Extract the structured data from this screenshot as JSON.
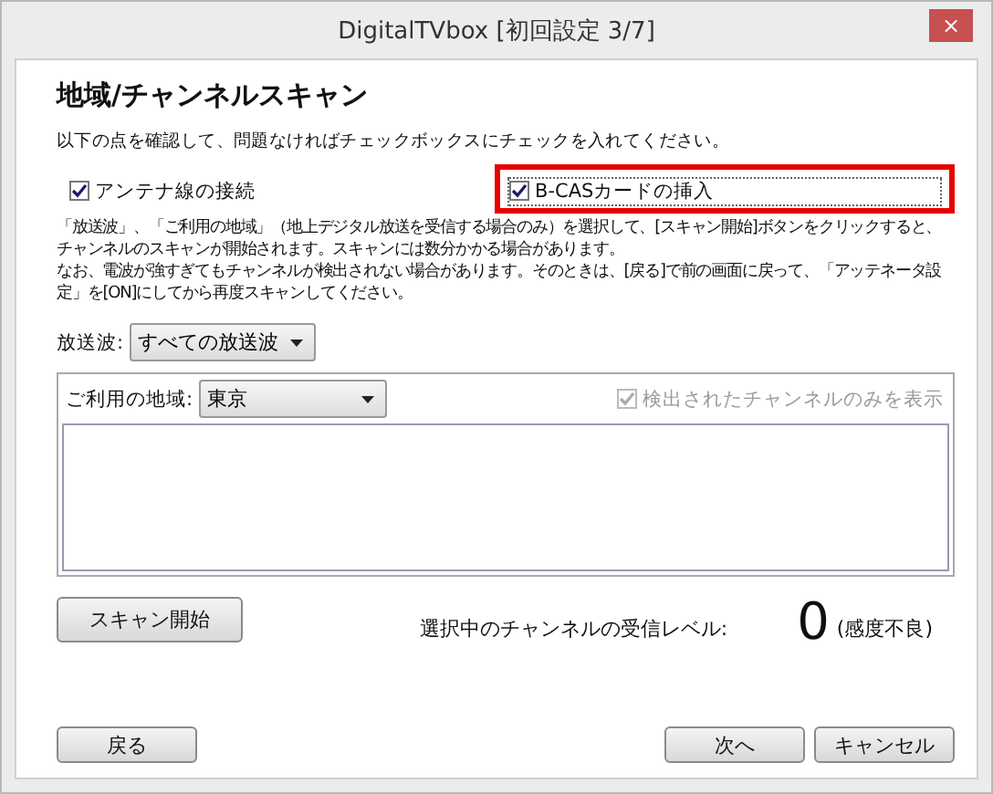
{
  "window": {
    "title": "DigitalTVbox [初回設定 3/7]",
    "close": "×"
  },
  "heading": "地域/チャンネルスキャン",
  "instruction": "以下の点を確認して、問題なければチェックボックスにチェックを入れてください。",
  "checklist": [
    {
      "label": "アンテナ線の接続",
      "checked": true,
      "highlighted": false
    },
    {
      "label": "B-CASカードの挿入",
      "checked": true,
      "highlighted": true
    }
  ],
  "paragraphs": [
    "「放送波」、「ご利用の地域」（地上デジタル放送を受信する場合のみ）を選択して、[スキャン開始]ボタンをクリックすると、チャンネルのスキャンが開始されます。スキャンには数分かかる場合があります。",
    "なお、電波が強すぎてもチャンネルが検出されない場合があります。そのときは、[戻る]で前の画面に戻って、「アッテネータ設定」を[ON]にしてから再度スキャンしてください。"
  ],
  "broadcast": {
    "label": "放送波:",
    "value": "すべての放送波"
  },
  "region": {
    "label": "ご利用の地域:",
    "value": "東京"
  },
  "detected_only": {
    "label": "検出されたチャンネルのみを表示",
    "checked": true,
    "disabled": true
  },
  "scan_button": "スキャン開始",
  "signal": {
    "label": "選択中のチャンネルの受信レベル:",
    "value": "0",
    "quality": "(感度不良)"
  },
  "buttons": [
    {
      "label": "戻る",
      "kind": "back"
    },
    {
      "label": "次へ",
      "kind": "next"
    },
    {
      "label": "キャンセル",
      "kind": "cancel"
    }
  ]
}
